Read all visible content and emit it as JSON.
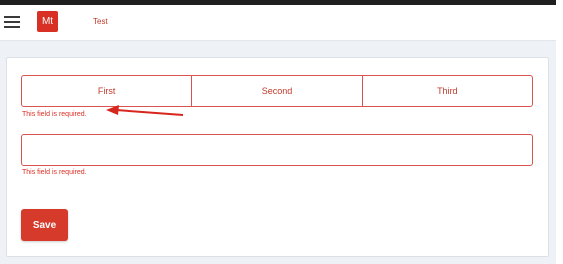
{
  "header": {
    "menu_icon": "hamburger-menu-icon",
    "logo_text": "Mt",
    "title": "Test"
  },
  "form": {
    "segments": [
      {
        "label": "First"
      },
      {
        "label": "Second"
      },
      {
        "label": "Third"
      }
    ],
    "segment_error": "This field is required.",
    "text_field": {
      "value": "",
      "placeholder": ""
    },
    "text_error": "This field is required.",
    "save_label": "Save"
  },
  "colors": {
    "accent": "#d93025",
    "error_border": "#d9534f",
    "page_background": "#eef1f5"
  }
}
